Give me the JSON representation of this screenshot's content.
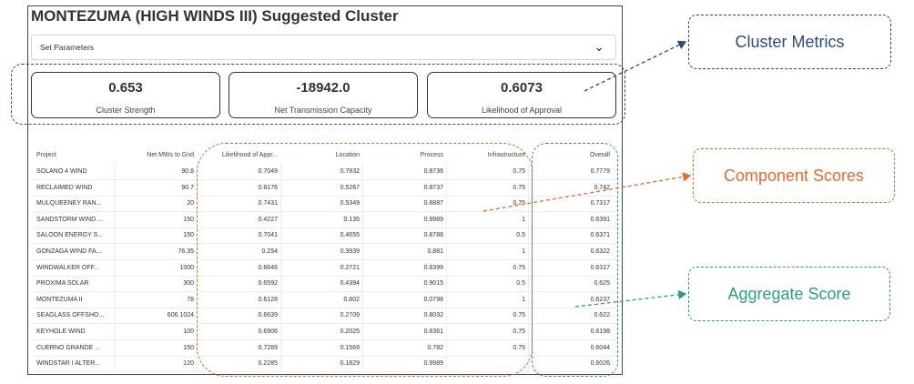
{
  "page_title": "MONTEZUMA (HIGH WINDS III) Suggested Cluster",
  "parameters_label": "Set Parameters",
  "parameters_chevron": "⌄",
  "metrics": [
    {
      "value": "0.653",
      "label": "Cluster Strength"
    },
    {
      "value": "-18942.0",
      "label": "Net Transmission Capacity"
    },
    {
      "value": "0.6073",
      "label": "Likelihood of Approval"
    }
  ],
  "table": {
    "headers": [
      "Project",
      "Net MWs to Grid",
      "Likelihood of Appr...",
      "Location",
      "Process",
      "Infrastructure",
      "Overall"
    ],
    "rows": [
      [
        "SOLANO 4 WIND",
        "90.8",
        "0.7049",
        "0.7832",
        "0.8736",
        "0.75",
        "0.7779"
      ],
      [
        "RECLAIMED WIND",
        "90.7",
        "0.8176",
        "0.5267",
        "0.8737",
        "0.75",
        "0.742"
      ],
      [
        "MULQUEENEY RAN...",
        "20",
        "0.7431",
        "0.5349",
        "0.8887",
        "0.75",
        "0.7317"
      ],
      [
        "SANDSTORM WIND ...",
        "150",
        "0.4227",
        "0.135",
        "0.9989",
        "1",
        "0.6391"
      ],
      [
        "SALOON ENERGY S...",
        "150",
        "0.7041",
        "0.4655",
        "0.8788",
        "0.5",
        "0.6371"
      ],
      [
        "GONZAGA WIND FA...",
        "76.35",
        "0.254",
        "0.3939",
        "0.881",
        "1",
        "0.6322"
      ],
      [
        "WINDWALKER OFF...",
        "1000",
        "0.6646",
        "0.2721",
        "0.8399",
        "0.75",
        "0.6317"
      ],
      [
        "PROXIMA SOLAR",
        "300",
        "0.6592",
        "0.4394",
        "0.9015",
        "0.5",
        "0.625"
      ],
      [
        "MONTEZUMA II",
        "78",
        "0.6128",
        "0.802",
        "0.0798",
        "1",
        "0.6237"
      ],
      [
        "SEAGLASS OFFSHO...",
        "606.1024",
        "0.6639",
        "0.2709",
        "0.8032",
        "0.75",
        "0.622"
      ],
      [
        "KEYHOLE WIND",
        "100",
        "0.6906",
        "0.2025",
        "0.8361",
        "0.75",
        "0.6198"
      ],
      [
        "CUERNO GRANDE ...",
        "150",
        "0.7289",
        "0.1569",
        "0.782",
        "0.75",
        "0.6044"
      ],
      [
        "WINDSTAR I ALTER...",
        "120",
        "0.2285",
        "0.1829",
        "0.9989",
        "",
        "0.6026"
      ]
    ]
  },
  "callouts": {
    "cluster_metrics": "Cluster Metrics",
    "component_scores": "Component Scores",
    "aggregate_score": "Aggregate Score"
  },
  "colors": {
    "navy": "#2d4a7a",
    "orange": "#e8692a",
    "teal": "#2a9d86"
  }
}
